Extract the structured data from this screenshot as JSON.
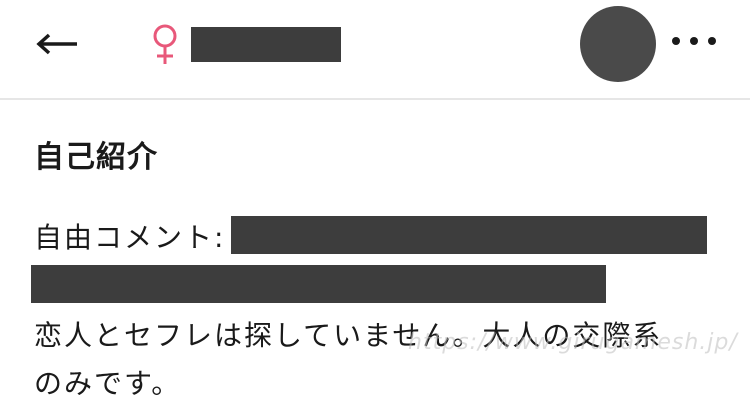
{
  "header": {
    "back_icon": "arrow-left-icon",
    "gender_icon": "female-symbol-icon",
    "gender_color": "#e8587a",
    "more_icon": "more-horizontal-icon"
  },
  "profile": {
    "section_title": "自己紹介",
    "free_comment_label": "自由コメント:",
    "body_line_1": "恋人とセフレは探していません。大人の交際系",
    "body_line_2": "のみです。"
  },
  "watermark": "https://www.girugamesh.jp/",
  "colors": {
    "redaction": "#3d3d3d",
    "divider": "#e6e6e6",
    "text": "#1a1a1a"
  }
}
